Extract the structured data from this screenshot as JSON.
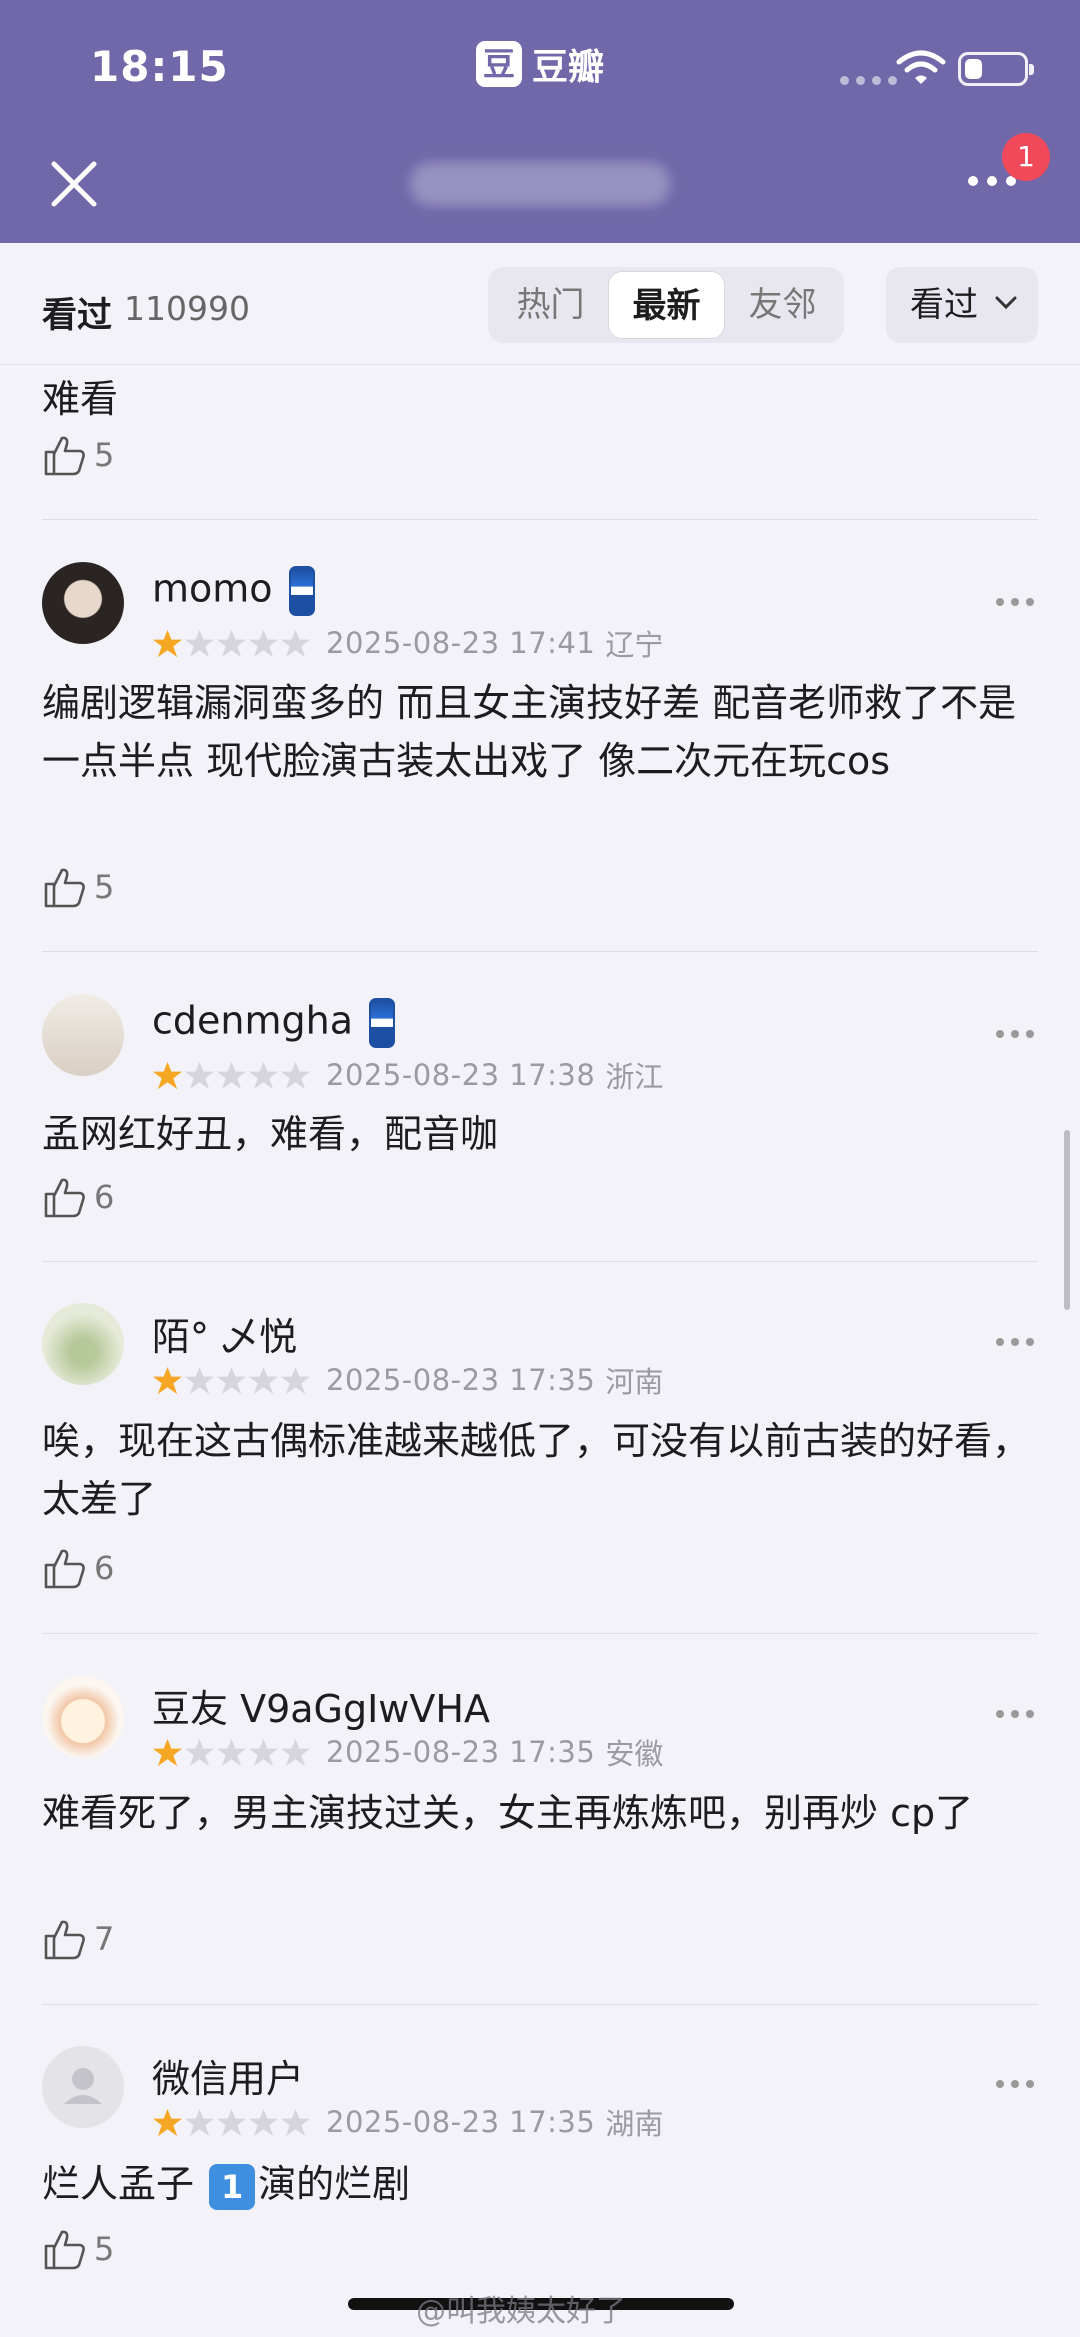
{
  "status_bar": {
    "time": "18:15",
    "battery_level": 0.3
  },
  "app": {
    "logo_char": "豆",
    "name": "豆瓣"
  },
  "nav": {
    "badge": "1"
  },
  "filter": {
    "seen_label": "看过",
    "seen_count": "110990",
    "tabs": [
      {
        "label": "热门",
        "active": false
      },
      {
        "label": "最新",
        "active": true
      },
      {
        "label": "友邻",
        "active": false
      }
    ],
    "dropdown_label": "看过"
  },
  "top_partial": {
    "text": "难看",
    "likes": "5"
  },
  "comments": [
    {
      "user": "momo",
      "rating": 1,
      "time": "2025-08-23 17:41",
      "location": "辽宁",
      "text": "编剧逻辑漏洞蛮多的 而且女主演技好差 配音老师救了不是一点半点  现代脸演古装太出戏了 像二次元在玩cos",
      "likes": "5"
    },
    {
      "user": "cdenmgha",
      "rating": 1,
      "time": "2025-08-23 17:38",
      "location": "浙江",
      "text": "孟网红好丑，难看，配音咖",
      "likes": "6"
    },
    {
      "user": "陌° 乄悦",
      "rating": 1,
      "time": "2025-08-23 17:35",
      "location": "河南",
      "text": "唉，现在这古偶标准越来越低了，可没有以前古装的好看，太差了",
      "likes": "6"
    },
    {
      "user": "豆友 V9aGgIwVHA",
      "rating": 1,
      "time": "2025-08-23 17:35",
      "location": "安徽",
      "text": "难看死了，男主演技过关，女主再炼炼吧，别再炒 cp了",
      "likes": "7"
    },
    {
      "user": "微信用户",
      "rating": 1,
      "time": "2025-08-23 17:35",
      "location": "湖南",
      "text_before": "烂人孟子 ",
      "text_emoji": "1",
      "text_after": "演的烂剧",
      "likes": "5"
    }
  ],
  "watermark": "@叫我姨太好了"
}
